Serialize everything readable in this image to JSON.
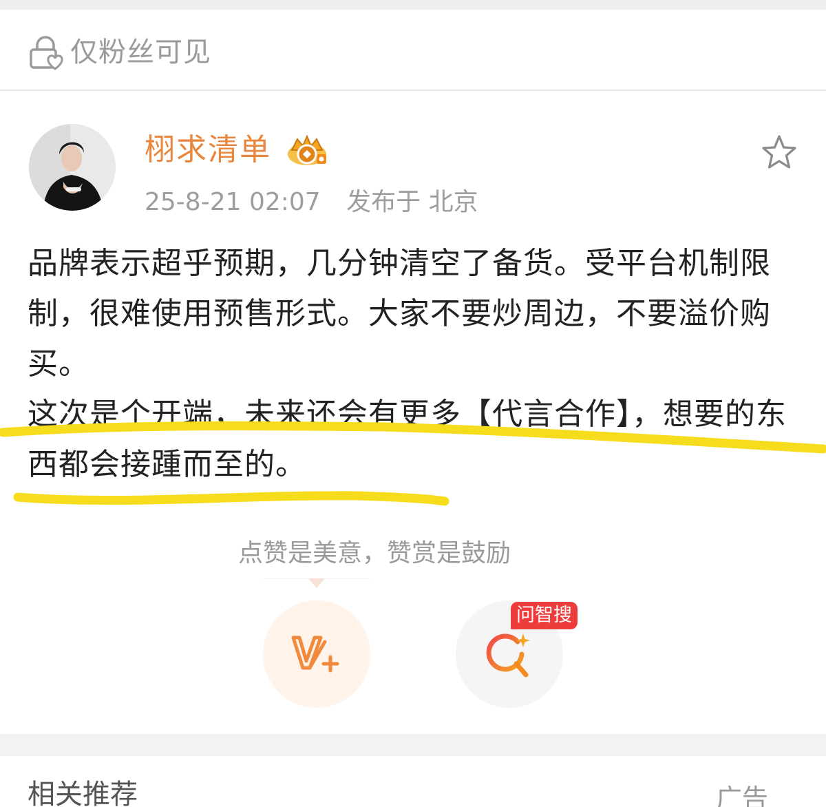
{
  "visibility": {
    "label": "仅粉丝可见"
  },
  "post": {
    "author": {
      "name": "栩求清单"
    },
    "timestamp": "25-8-21 02:07",
    "location": "发布于 北京",
    "paragraph1": "品牌表示超乎预期，几分钟清空了备货。受平台机制限制，很难使用预售形式。大家不要炒周边，不要溢价购买。",
    "paragraph2": "这次是个开端，未来还会有更多【代言合作】，想要的东西都会接踵而至的。"
  },
  "reward": {
    "hint": "点赞是美意，赞赏是鼓励"
  },
  "actions": {
    "ask_badge": "问智搜"
  },
  "related": {
    "title": "相关推荐",
    "extra": "广告"
  },
  "colors": {
    "username": "#e8863e",
    "highlight_underline": "#f5dc1c",
    "badge_red": "#ee3b3b",
    "vplus_orange": "#f08a3c"
  },
  "icons": [
    "lock-fans-icon",
    "crown-badge-icon",
    "star-icon",
    "vplus-icon",
    "ai-search-icon"
  ]
}
